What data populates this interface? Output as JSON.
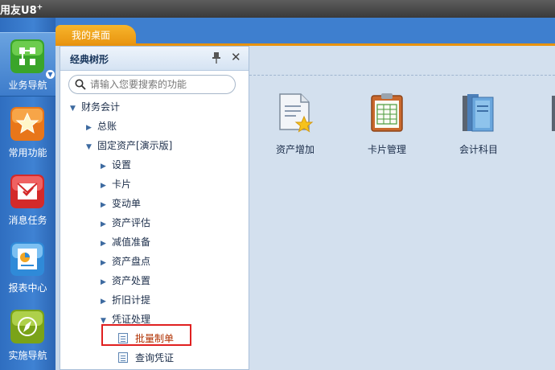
{
  "app": {
    "logo_text": "用友",
    "logo_brand": "U8",
    "logo_sup": "+"
  },
  "rail": [
    {
      "label": "业务导航",
      "icon": "business-nav-icon",
      "active": true
    },
    {
      "label": "常用功能",
      "icon": "star-icon"
    },
    {
      "label": "消息任务",
      "icon": "message-icon"
    },
    {
      "label": "报表中心",
      "icon": "report-icon"
    },
    {
      "label": "实施导航",
      "icon": "compass-icon"
    }
  ],
  "tabs": [
    {
      "label": "我的桌面"
    }
  ],
  "panel": {
    "title": "经典树形",
    "search_placeholder": "请输入您要搜索的功能"
  },
  "tree": {
    "finance": "财务会计",
    "ledger": "总账",
    "fixed_assets": "固定资产[演示版]",
    "settings": "设置",
    "card": "卡片",
    "change": "变动单",
    "evaluate": "资产评估",
    "impairment": "减值准备",
    "inventory": "资产盘点",
    "disposal": "资产处置",
    "depreciation": "折旧计提",
    "voucher": "凭证处理",
    "batch": "批量制单",
    "query": "查询凭证"
  },
  "desktop": [
    {
      "label": "资产增加",
      "icon": "asset-add-icon"
    },
    {
      "label": "卡片管理",
      "icon": "card-manage-icon"
    },
    {
      "label": "会计科目",
      "icon": "account-book-icon"
    }
  ],
  "colors": {
    "accent_orange": "#e8930f",
    "rail_blue": "#3f82d3",
    "highlight_red": "#e02020"
  }
}
